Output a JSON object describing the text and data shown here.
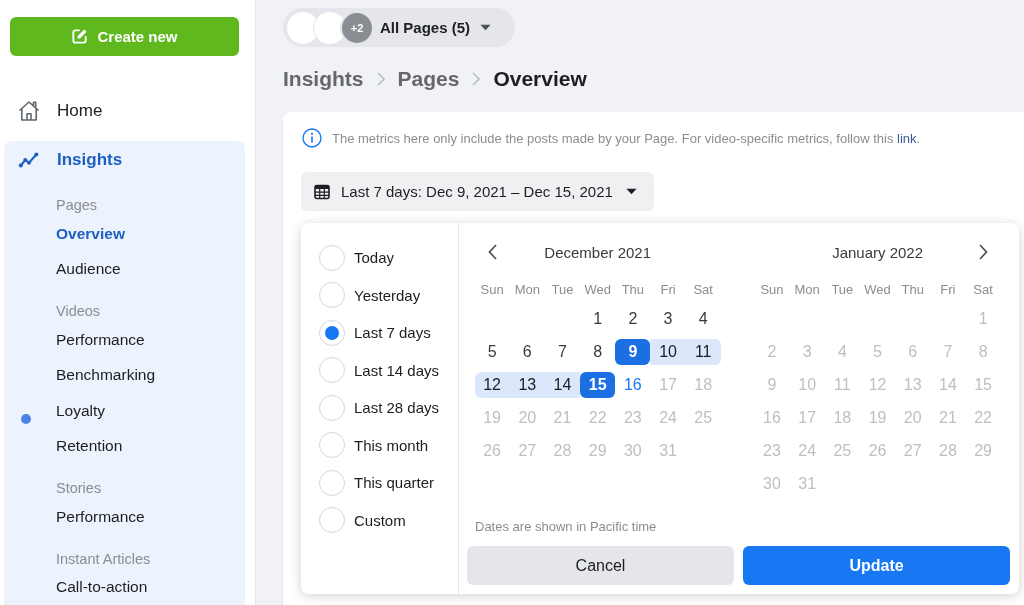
{
  "sidebar": {
    "create_button": "Create new",
    "items": [
      {
        "label": "Home",
        "selected": false
      },
      {
        "label": "Insights",
        "selected": true,
        "expanded": true,
        "children": [
          {
            "label": "Pages",
            "children": [
              {
                "label": "Overview",
                "selected": true,
                "new": false
              },
              {
                "label": "Audience",
                "selected": false,
                "new": false
              }
            ]
          },
          {
            "label": "Videos",
            "children": [
              {
                "label": "Performance",
                "selected": false,
                "new": false
              },
              {
                "label": "Benchmarking",
                "selected": false,
                "new": false
              },
              {
                "label": "Loyalty",
                "selected": false,
                "new": true
              },
              {
                "label": "Retention",
                "selected": false,
                "new": false
              }
            ]
          },
          {
            "label": "Stories",
            "children": [
              {
                "label": "Performance",
                "selected": false,
                "new": false
              }
            ]
          },
          {
            "label": "Instant Articles",
            "children": [
              {
                "label": "Call-to-action",
                "selected": false,
                "new": false
              }
            ]
          }
        ]
      }
    ]
  },
  "page_switcher": {
    "avatars": [
      {
        "kind": "photo"
      },
      {
        "kind": "photo"
      },
      {
        "kind": "count",
        "text": "+2"
      }
    ],
    "label": "All Pages (5)"
  },
  "breadcrumb": [
    {
      "label": "Insights",
      "current": false
    },
    {
      "label": "Pages",
      "current": false
    },
    {
      "label": "Overview",
      "current": true
    }
  ],
  "notice": {
    "text": "The metrics here only include the posts made by your Page. For video-specific metrics, follow this ",
    "link": "link",
    "after": "."
  },
  "date_range": {
    "label": "Last 7 days: Dec 9, 2021 – Dec 15, 2021",
    "expanded": true
  },
  "calendar": {
    "presets": [
      {
        "label": "Today",
        "selected": false
      },
      {
        "label": "Yesterday",
        "selected": false
      },
      {
        "label": "Last 7 days",
        "selected": true
      },
      {
        "label": "Last 14 days",
        "selected": false
      },
      {
        "label": "Last 28 days",
        "selected": false
      },
      {
        "label": "This month",
        "selected": false
      },
      {
        "label": "This quarter",
        "selected": false
      },
      {
        "label": "Custom",
        "selected": false
      }
    ],
    "months": [
      {
        "title": "December 2021",
        "kind": "prev",
        "weekdays": [
          "Sun",
          "Mon",
          "Tue",
          "Wed",
          "Thu",
          "Fri",
          "Sat"
        ],
        "weeks": [
          [
            {
              "day": "1",
              "kind": "normal",
              "selected": false
            },
            {
              "day": "2",
              "kind": "normal",
              "selected": false
            },
            {
              "day": "3",
              "kind": "normal",
              "selected": false
            },
            {
              "day": "4",
              "kind": "normal",
              "selected": false
            }
          ],
          [
            {
              "day": "5",
              "kind": "normal",
              "selected": false
            },
            {
              "day": "6",
              "kind": "normal",
              "selected": false
            },
            {
              "day": "7",
              "kind": "normal",
              "selected": false
            },
            {
              "day": "8",
              "kind": "normal",
              "selected": false
            },
            {
              "day": "9",
              "kind": "range",
              "selected": true
            },
            {
              "day": "10",
              "kind": "range",
              "selected": false
            },
            {
              "day": "11",
              "kind": "range",
              "selected": false
            }
          ],
          [
            {
              "day": "12",
              "kind": "range",
              "selected": false
            },
            {
              "day": "13",
              "kind": "range",
              "selected": false
            },
            {
              "day": "14",
              "kind": "range",
              "selected": false
            },
            {
              "day": "15",
              "kind": "range",
              "selected": true
            },
            {
              "day": "16",
              "kind": "today",
              "selected": false
            },
            {
              "day": "17",
              "kind": "disabled",
              "selected": false
            },
            {
              "day": "18",
              "kind": "disabled",
              "selected": false
            }
          ],
          [
            {
              "day": "19",
              "kind": "disabled",
              "selected": false
            },
            {
              "day": "20",
              "kind": "disabled",
              "selected": false
            },
            {
              "day": "21",
              "kind": "disabled",
              "selected": false
            },
            {
              "day": "22",
              "kind": "disabled",
              "selected": false
            },
            {
              "day": "23",
              "kind": "disabled",
              "selected": false
            },
            {
              "day": "24",
              "kind": "disabled",
              "selected": false
            },
            {
              "day": "25",
              "kind": "disabled",
              "selected": false
            }
          ],
          [
            {
              "day": "26",
              "kind": "disabled",
              "selected": false
            },
            {
              "day": "27",
              "kind": "disabled",
              "selected": false
            },
            {
              "day": "28",
              "kind": "disabled",
              "selected": false
            },
            {
              "day": "29",
              "kind": "disabled",
              "selected": false
            },
            {
              "day": "30",
              "kind": "disabled",
              "selected": false
            },
            {
              "day": "31",
              "kind": "disabled",
              "selected": false
            }
          ]
        ]
      },
      {
        "title": "January 2022",
        "kind": "next",
        "weekdays": [
          "Sun",
          "Mon",
          "Tue",
          "Wed",
          "Thu",
          "Fri",
          "Sat"
        ],
        "weeks": [
          [
            {
              "day": "1",
              "kind": "disabled",
              "selected": false
            }
          ],
          [
            {
              "day": "2",
              "kind": "disabled",
              "selected": false
            },
            {
              "day": "3",
              "kind": "disabled",
              "selected": false
            },
            {
              "day": "4",
              "kind": "disabled",
              "selected": false
            },
            {
              "day": "5",
              "kind": "disabled",
              "selected": false
            },
            {
              "day": "6",
              "kind": "disabled",
              "selected": false
            },
            {
              "day": "7",
              "kind": "disabled",
              "selected": false
            },
            {
              "day": "8",
              "kind": "disabled",
              "selected": false
            }
          ],
          [
            {
              "day": "9",
              "kind": "disabled",
              "selected": false
            },
            {
              "day": "10",
              "kind": "disabled",
              "selected": false
            },
            {
              "day": "11",
              "kind": "disabled",
              "selected": false
            },
            {
              "day": "12",
              "kind": "disabled",
              "selected": false
            },
            {
              "day": "13",
              "kind": "disabled",
              "selected": false
            },
            {
              "day": "14",
              "kind": "disabled",
              "selected": false
            },
            {
              "day": "15",
              "kind": "disabled",
              "selected": false
            }
          ],
          [
            {
              "day": "16",
              "kind": "disabled",
              "selected": false
            },
            {
              "day": "17",
              "kind": "disabled",
              "selected": false
            },
            {
              "day": "18",
              "kind": "disabled",
              "selected": false
            },
            {
              "day": "19",
              "kind": "disabled",
              "selected": false
            },
            {
              "day": "20",
              "kind": "disabled",
              "selected": false
            },
            {
              "day": "21",
              "kind": "disabled",
              "selected": false
            },
            {
              "day": "22",
              "kind": "disabled",
              "selected": false
            }
          ],
          [
            {
              "day": "23",
              "kind": "disabled",
              "selected": false
            },
            {
              "day": "24",
              "kind": "disabled",
              "selected": false
            },
            {
              "day": "25",
              "kind": "disabled",
              "selected": false
            },
            {
              "day": "26",
              "kind": "disabled",
              "selected": false
            },
            {
              "day": "27",
              "kind": "disabled",
              "selected": false
            },
            {
              "day": "28",
              "kind": "disabled",
              "selected": false
            },
            {
              "day": "29",
              "kind": "disabled",
              "selected": false
            }
          ],
          [
            {
              "day": "30",
              "kind": "disabled",
              "selected": false
            },
            {
              "day": "31",
              "kind": "disabled",
              "selected": false
            }
          ]
        ]
      }
    ],
    "note": "Dates are shown in Pacific time",
    "buttons": [
      {
        "label": "Cancel",
        "kind": "secondary"
      },
      {
        "label": "Update",
        "kind": "primary"
      }
    ]
  }
}
